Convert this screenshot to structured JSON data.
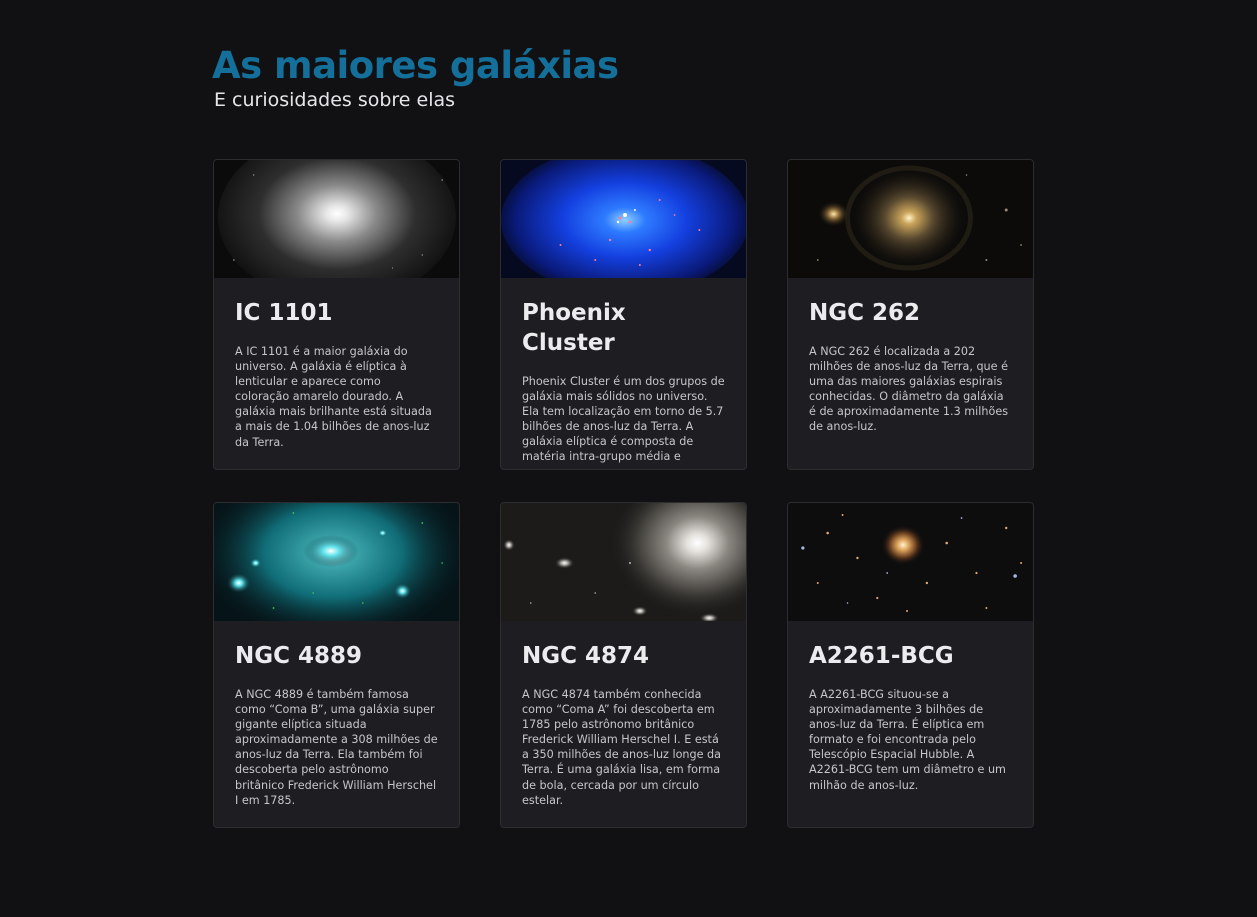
{
  "header": {
    "title": "As maiores galáxias",
    "subtitle": "E curiosidades sobre elas"
  },
  "colors": {
    "background": "#111113",
    "title": "#14709a",
    "card": "#1e1e22"
  },
  "cards": [
    {
      "image": "elliptical-galaxy-white-image",
      "title": "IC 1101",
      "text": "A IC 1101 é a maior galáxia do universo. A galáxia é elíptica à lenticular e aparece como coloração amarelo dourado. A galáxia mais brilhante está situada a mais de 1.04 bilhões de anos-luz da Terra."
    },
    {
      "image": "blue-cluster-image",
      "title": "Phoenix Cluster",
      "text": "Phoenix Cluster é um dos grupos de galáxia mais sólidos no universo. Ela tem localização em torno de 5.7 bilhões de anos-luz da Terra. A galáxia elíptica é composta de matéria intra-grupo média e escura."
    },
    {
      "image": "golden-spiral-galaxy-image",
      "title": "NGC 262",
      "text": "A NGC 262 é localizada a 202 milhões de anos-luz da Terra, que é uma das maiores galáxias espirais conhecidas. O diâmetro da galáxia é de aproximadamente 1.3 milhões de anos-luz."
    },
    {
      "image": "cyan-coma-cluster-image",
      "title": "NGC 4889",
      "text": "A NGC 4889 é também famosa como “Coma B”, uma galáxia super gigante elíptica situada aproximadamente a 308 milhões de anos-luz da Terra. Ela também foi descoberta pelo astrônomo britânico Frederick William Herschel I em 1785."
    },
    {
      "image": "gray-elliptical-galaxy-image",
      "title": "NGC 4874",
      "text": "A NGC 4874 também conhecida como “Coma A” foi descoberta em 1785 pelo astrônomo britânico Frederick William Herschel I. E está a 350 milhões de anos-luz longe da Terra. É uma galáxia lisa, em forma de bola, cercada por um círculo estelar."
    },
    {
      "image": "deep-field-cluster-image",
      "title": "A2261-BCG",
      "text": "A A2261-BCG situou-se a aproximadamente 3 bilhões de anos-luz da Terra. É elíptica em formato e foi encontrada pelo Telescópio Espacial Hubble. A A2261-BCG tem um diâmetro e um milhão de anos-luz."
    }
  ]
}
